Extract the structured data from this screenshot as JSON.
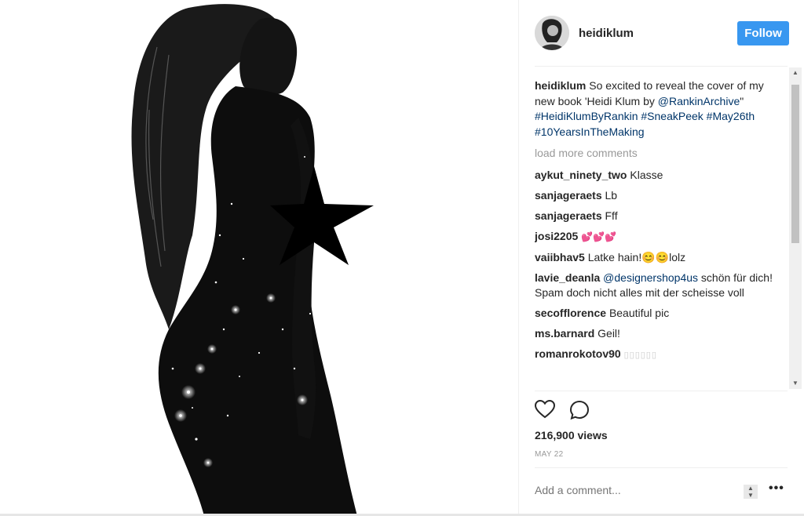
{
  "header": {
    "username": "heidiklum",
    "follow_label": "Follow"
  },
  "caption": {
    "username": "heidiklum",
    "text": "So excited to reveal the cover of my new book 'Heidi Klum by ",
    "mention": "@RankinArchive",
    "text2": "\" ",
    "hashtags": "#HeidiKlumByRankin #SneakPeek #May26th #10YearsInTheMaking"
  },
  "load_more": "load more comments",
  "comments": [
    {
      "user": "aykut_ninety_two",
      "text": "Klasse"
    },
    {
      "user": "sanjageraets",
      "text": "Lb"
    },
    {
      "user": "sanjageraets",
      "text": "Fff"
    },
    {
      "user": "josi2205",
      "text": "💕💕💕"
    },
    {
      "user": "vaiibhav5",
      "text": "Latke hain!😊😊lolz"
    },
    {
      "user": "lavie_deanla",
      "mention": "@designershop4us",
      "text": "schön für dich! Spam doch nicht alles mit der scheisse voll"
    },
    {
      "user": "secofflorence",
      "text": "Beautiful pic"
    },
    {
      "user": "ms.barnard",
      "text": "Geil!"
    },
    {
      "user": "romanrokotov90",
      "text": "▯▯▯▯▯▯"
    }
  ],
  "icons": {
    "like": "heart-icon",
    "comment": "comment-icon",
    "more": "more-options-icon"
  },
  "views": "216,900 views",
  "date": "MAY 22",
  "add_comment_placeholder": "Add a comment...",
  "more_label": "•••",
  "colors": {
    "follow_bg": "#3897f0",
    "link": "#003569",
    "muted": "#999999"
  }
}
